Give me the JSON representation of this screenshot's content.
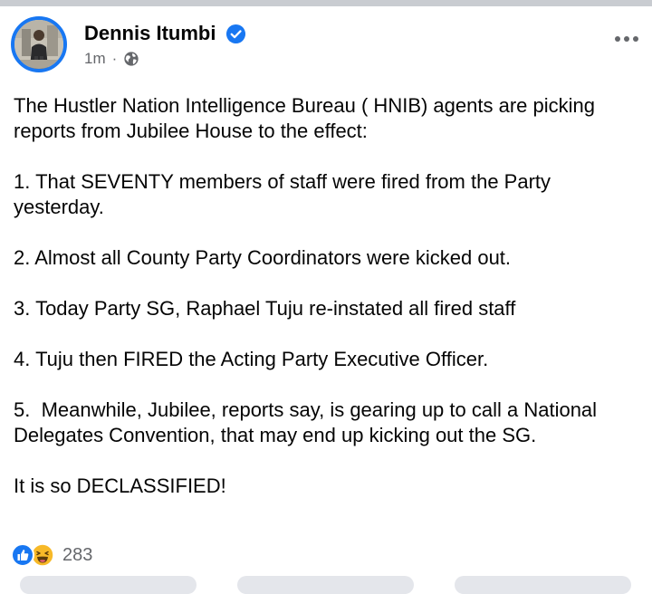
{
  "post": {
    "author": "Dennis Itumbi",
    "timestamp": "1m",
    "separator": "·",
    "paragraphs": [
      "The Hustler Nation Intelligence Bureau ( HNIB) agents are picking reports from Jubilee House to the effect:",
      "1. That SEVENTY members of staff were fired from the Party yesterday.",
      "2. Almost all County Party Coordinators were kicked out.",
      "3. Today Party SG, Raphael Tuju re-instated all fired staff",
      "4. Tuju then FIRED the Acting Party Executive Officer.",
      "5.  Meanwhile, Jubilee, reports say, is gearing up to call a National Delegates Convention, that may end up kicking out the SG.",
      "It is so DECLASSIFIED!"
    ],
    "reactions": {
      "count": "283",
      "types": [
        "like-icon",
        "haha-icon"
      ]
    }
  },
  "colors": {
    "verified": "#1877f2",
    "avatar_ring": "#1877f2",
    "meta_text": "#65676b",
    "body_text": "#050505",
    "like": "#1877f2",
    "haha": "#f7b928"
  },
  "icons": {
    "verified": "verified-badge-icon",
    "audience": "globe-icon",
    "menu": "more-options-icon"
  }
}
